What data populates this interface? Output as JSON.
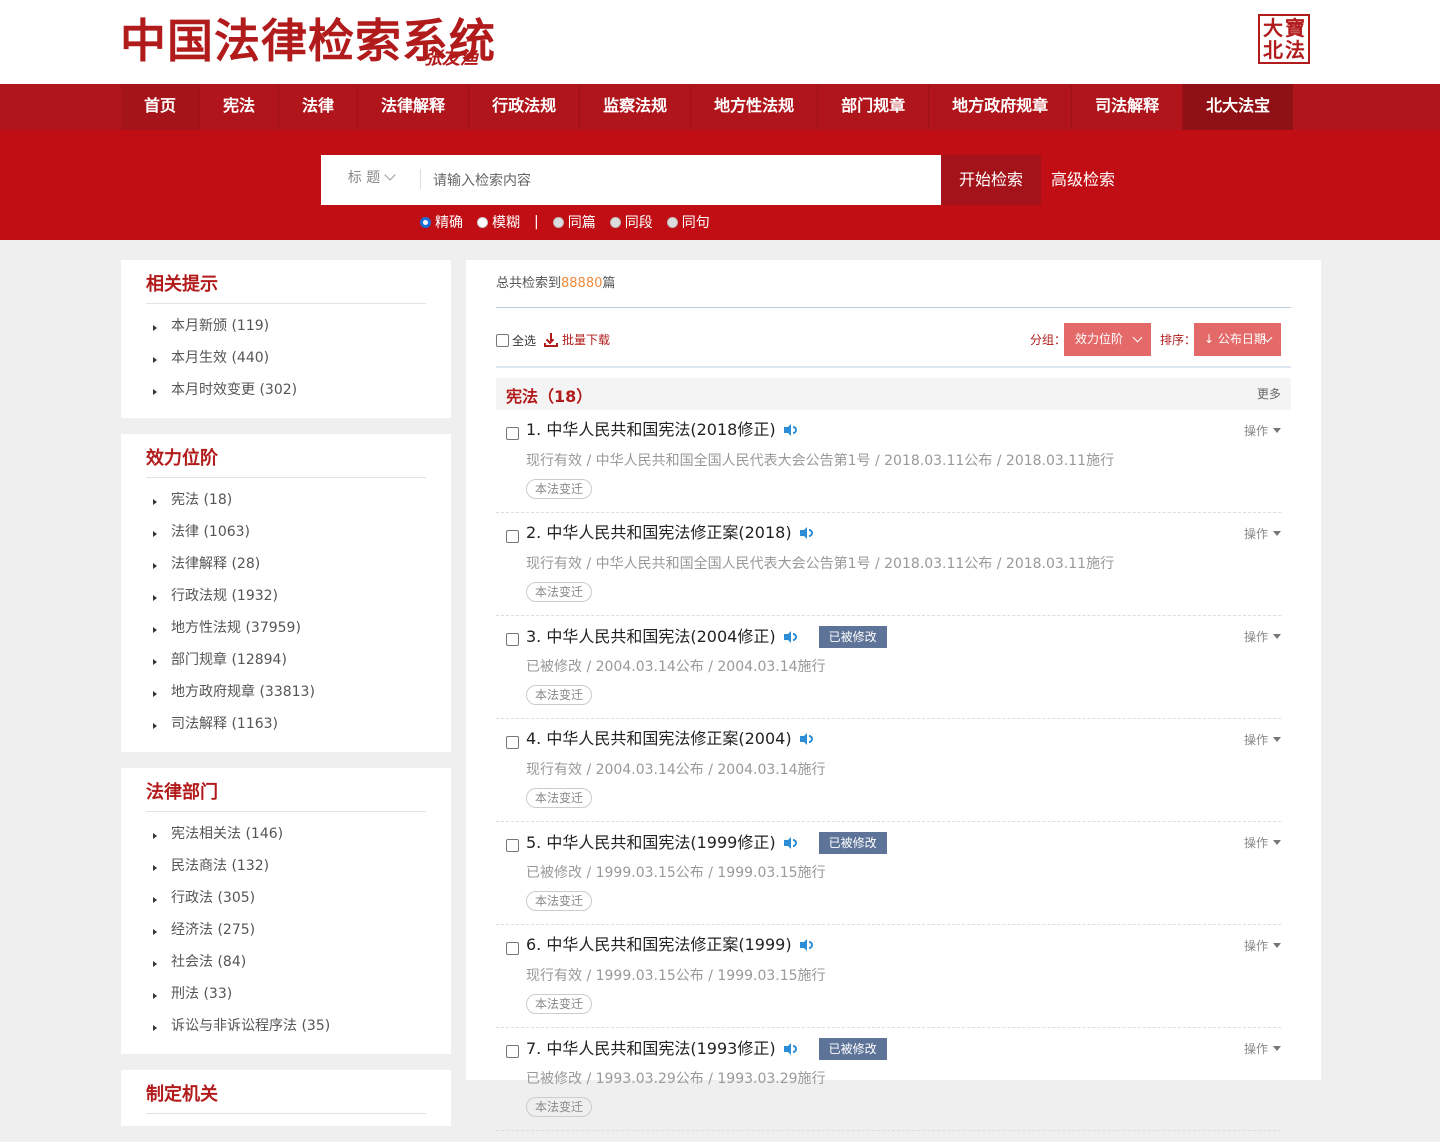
{
  "header": {
    "logo_text": "中国法律检索系统",
    "logo_signature": "张友渔",
    "seal_chars": [
      "北",
      "大",
      "法",
      "寶"
    ]
  },
  "nav": {
    "items": [
      "首页",
      "宪法",
      "法律",
      "法律解释",
      "行政法规",
      "监察法规",
      "地方性法规",
      "部门规章",
      "地方政府规章",
      "司法解释",
      "北大法宝"
    ]
  },
  "search": {
    "field_type": "标 题",
    "placeholder": "请输入检索内容",
    "submit_label": "开始检索",
    "advanced_label": "高级检索",
    "options": [
      {
        "label": "精确",
        "selected": true,
        "disabled": false
      },
      {
        "label": "模糊",
        "selected": false,
        "disabled": false
      },
      {
        "label": "同篇",
        "selected": false,
        "disabled": true
      },
      {
        "label": "同段",
        "selected": false,
        "disabled": true
      },
      {
        "label": "同句",
        "selected": false,
        "disabled": true
      }
    ],
    "separator": "|"
  },
  "sidebar": {
    "panels": [
      {
        "title": "相关提示",
        "items": [
          "本月新颁 (119)",
          "本月生效 (440)",
          "本月时效变更 (302)"
        ]
      },
      {
        "title": "效力位阶",
        "items": [
          "宪法 (18)",
          "法律 (1063)",
          "法律解释 (28)",
          "行政法规 (1932)",
          "地方性法规 (37959)",
          "部门规章 (12894)",
          "地方政府规章 (33813)",
          "司法解释 (1163)"
        ]
      },
      {
        "title": "法律部门",
        "items": [
          "宪法相关法 (146)",
          "民法商法 (132)",
          "行政法 (305)",
          "经济法 (275)",
          "社会法 (84)",
          "刑法 (33)",
          "诉讼与非诉讼程序法 (35)"
        ]
      },
      {
        "title": "制定机关",
        "items": []
      }
    ]
  },
  "main": {
    "total_prefix": "总共检索到",
    "total_count": "88880",
    "total_suffix": "篇",
    "select_all": "全选",
    "batch_download": "批量下载",
    "group_label": "分组：",
    "group_value": "效力位阶",
    "sort_label": "排序：",
    "sort_value": "↓ 公布日期",
    "group_title": "宪法（18）",
    "more_label": "更多",
    "operate_label": "操作",
    "tag_label": "本法变迁",
    "modified_label": "已被修改",
    "results": [
      {
        "title": "1. 中华人民共和国宪法(2018修正)",
        "meta": "现行有效 / 中华人民共和国全国人民代表大会公告第1号 / 2018.03.11公布 / 2018.03.11施行",
        "modified": false
      },
      {
        "title": "2. 中华人民共和国宪法修正案(2018)",
        "meta": "现行有效 / 中华人民共和国全国人民代表大会公告第1号 / 2018.03.11公布 / 2018.03.11施行",
        "modified": false
      },
      {
        "title": "3. 中华人民共和国宪法(2004修正)",
        "meta": "已被修改 / 2004.03.14公布 / 2004.03.14施行",
        "modified": true
      },
      {
        "title": "4. 中华人民共和国宪法修正案(2004)",
        "meta": "现行有效 / 2004.03.14公布 / 2004.03.14施行",
        "modified": false
      },
      {
        "title": "5. 中华人民共和国宪法(1999修正)",
        "meta": "已被修改 / 1999.03.15公布 / 1999.03.15施行",
        "modified": true
      },
      {
        "title": "6. 中华人民共和国宪法修正案(1999)",
        "meta": "现行有效 / 1999.03.15公布 / 1999.03.15施行",
        "modified": false
      },
      {
        "title": "7. 中华人民共和国宪法(1993修正)",
        "meta": "已被修改 / 1993.03.29公布 / 1993.03.29施行",
        "modified": true
      }
    ]
  }
}
